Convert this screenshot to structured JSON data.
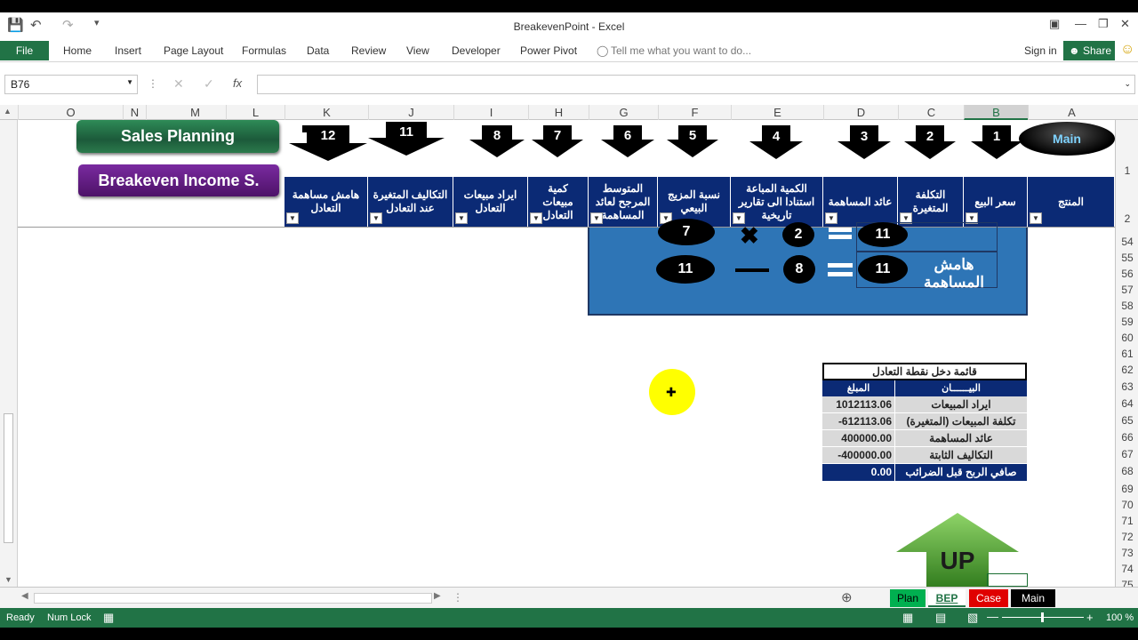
{
  "window": {
    "title": "BreakevenPoint - Excel"
  },
  "ribbon": {
    "file": "File",
    "tabs": [
      "Home",
      "Insert",
      "Page Layout",
      "Formulas",
      "Data",
      "Review",
      "View",
      "Developer",
      "Power Pivot"
    ],
    "tell_me": "Tell me what you want to do...",
    "sign_in": "Sign in",
    "share": "Share"
  },
  "formula_bar": {
    "name_box": "B76",
    "fx": "fx",
    "value": ""
  },
  "columns": [
    "O",
    "N",
    "M",
    "L",
    "K",
    "J",
    "I",
    "H",
    "G",
    "F",
    "E",
    "D",
    "C",
    "B",
    "A"
  ],
  "rows": [
    "1",
    "2",
    "54",
    "55",
    "56",
    "57",
    "58",
    "59",
    "60",
    "61",
    "62",
    "63",
    "64",
    "65",
    "66",
    "67",
    "68",
    "69",
    "70",
    "71",
    "72",
    "73",
    "74",
    "75"
  ],
  "buttons": {
    "sales_planning": "Sales Planning",
    "breakeven": "Breakeven Income S.",
    "main": "Main",
    "up": "UP"
  },
  "step_numbers": [
    "12",
    "11",
    "8",
    "7",
    "6",
    "5",
    "4",
    "3",
    "2",
    "1"
  ],
  "headers": [
    "هامش مساهمة التعادل",
    "التكاليف المتغيرة عند التعادل",
    "ايراد مبيعات التعادل",
    "كمية مبيعات التعادل",
    "المتوسط المرجح لعائد المساهمة",
    "نسبة المزيج البيعي",
    "الكمية المباعة استنادا الى تقارير تاريخية",
    "عائد المساهمة",
    "التكلفة المتغيرة",
    "سعر البيع",
    "المنتج"
  ],
  "formula_box": {
    "row1": {
      "a": "7",
      "b": "2",
      "c": "11"
    },
    "row2": {
      "label": "هامش المساهمة",
      "a": "11",
      "b": "8",
      "c": "11"
    }
  },
  "income_statement": {
    "title": "قائمة دخل نقطة التعادل",
    "col_label": "البيــــــان",
    "col_amount": "المبلغ",
    "rows": [
      {
        "label": "ايراد المبيعات",
        "amount": "1012113.06"
      },
      {
        "label": "تكلفة المبيعات (المتغيرة)",
        "amount": "-612113.06"
      },
      {
        "label": "عائد المساهمة",
        "amount": "400000.00"
      },
      {
        "label": "التكاليف الثابتة",
        "amount": "-400000.00"
      }
    ],
    "total": {
      "label": "صافي الربح قبل الضرائب",
      "amount": "0.00"
    }
  },
  "sheet_tabs": [
    {
      "name": "Plan",
      "color": "#00b050"
    },
    {
      "name": "BEP",
      "color": "#ffffff"
    },
    {
      "name": "Case",
      "color": "#e00000"
    },
    {
      "name": "Main",
      "color": "#000000"
    }
  ],
  "status": {
    "ready": "Ready",
    "numlock": "Num Lock",
    "zoom": "100 %"
  }
}
